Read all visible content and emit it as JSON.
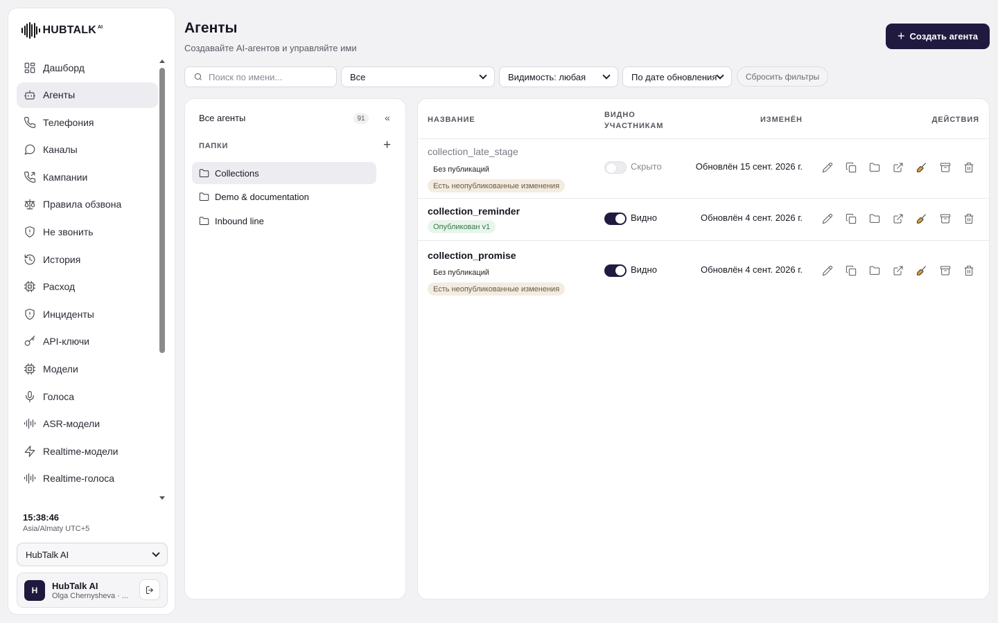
{
  "brand": {
    "name": "HUBTALK",
    "suffix": "AI"
  },
  "sidebar": {
    "items": [
      {
        "label": "Дашборд",
        "icon": "dashboard-icon"
      },
      {
        "label": "Агенты",
        "icon": "bot-icon",
        "active": true
      },
      {
        "label": "Телефония",
        "icon": "phone-icon"
      },
      {
        "label": "Каналы",
        "icon": "chat-bubble-icon"
      },
      {
        "label": "Кампании",
        "icon": "phone-outgoing-icon"
      },
      {
        "label": "Правила обзвона",
        "icon": "scale-icon"
      },
      {
        "label": "Не звонить",
        "icon": "shield-alert-icon"
      },
      {
        "label": "История",
        "icon": "history-icon"
      },
      {
        "label": "Расход",
        "icon": "chip-icon"
      },
      {
        "label": "Инциденты",
        "icon": "shield-alert-icon"
      },
      {
        "label": "API-ключи",
        "icon": "key-icon"
      },
      {
        "label": "Модели",
        "icon": "chip-icon"
      },
      {
        "label": "Голоса",
        "icon": "mic-icon"
      },
      {
        "label": "ASR-модели",
        "icon": "audio-lines-icon"
      },
      {
        "label": "Realtime-модели",
        "icon": "lightning-icon"
      },
      {
        "label": "Realtime-голоса",
        "icon": "audio-lines-icon"
      }
    ],
    "clock": {
      "time": "15:38:46",
      "tz": "Asia/Almaty UTC+5"
    },
    "workspace": "HubTalk AI",
    "user": {
      "initial": "H",
      "name": "HubTalk AI",
      "email": "Olga Chernysheva · ..."
    }
  },
  "header": {
    "title": "Агенты",
    "subtitle": "Создавайте AI-агентов и управляйте ими",
    "create_label": "Создать агента"
  },
  "filters": {
    "search_placeholder": "Поиск по имени...",
    "status": "Все",
    "visibility": "Видимость: любая",
    "sort": "По дате обновления",
    "reset": "Сбросить фильтры"
  },
  "folders": {
    "all_label": "Все агенты",
    "all_count": "91",
    "section_label": "ПАПКИ",
    "items": [
      {
        "label": "Collections",
        "active": true
      },
      {
        "label": "Demo & documentation"
      },
      {
        "label": "Inbound line"
      }
    ]
  },
  "table": {
    "headers": {
      "name": "НАЗВАНИЕ",
      "visible_line1": "ВИДНО",
      "visible_line2": "УЧАСТНИКАМ",
      "updated": "ИЗМЕНЁН",
      "actions": "ДЕЙСТВИЯ"
    },
    "rows": [
      {
        "name": "collection_late_stage",
        "muted": true,
        "tags": [
          {
            "text": "Без публикаций",
            "kind": "plain"
          },
          {
            "text": "Есть неопубликованные изменения",
            "kind": "warn"
          }
        ],
        "visible": false,
        "visibility_label": "Скрыто",
        "updated": "Обновлён 15 сент. 2026 г."
      },
      {
        "name": "collection_reminder",
        "muted": false,
        "tags": [
          {
            "text": "Опубликован v1",
            "kind": "ok"
          }
        ],
        "visible": true,
        "visibility_label": "Видно",
        "updated": "Обновлён 4 сент. 2026 г."
      },
      {
        "name": "collection_promise",
        "muted": false,
        "tags": [
          {
            "text": "Без публикаций",
            "kind": "plain"
          },
          {
            "text": "Есть неопубликованные изменения",
            "kind": "warn"
          }
        ],
        "visible": true,
        "visibility_label": "Видно",
        "updated": "Обновлён 4 сент. 2026 г."
      }
    ],
    "action_icons": [
      "edit-icon",
      "copy-icon",
      "folder-icon",
      "external-link-icon",
      "broom-icon",
      "archive-icon",
      "trash-icon"
    ]
  },
  "colors": {
    "accent": "#211a40",
    "broom": "#c78a12"
  }
}
